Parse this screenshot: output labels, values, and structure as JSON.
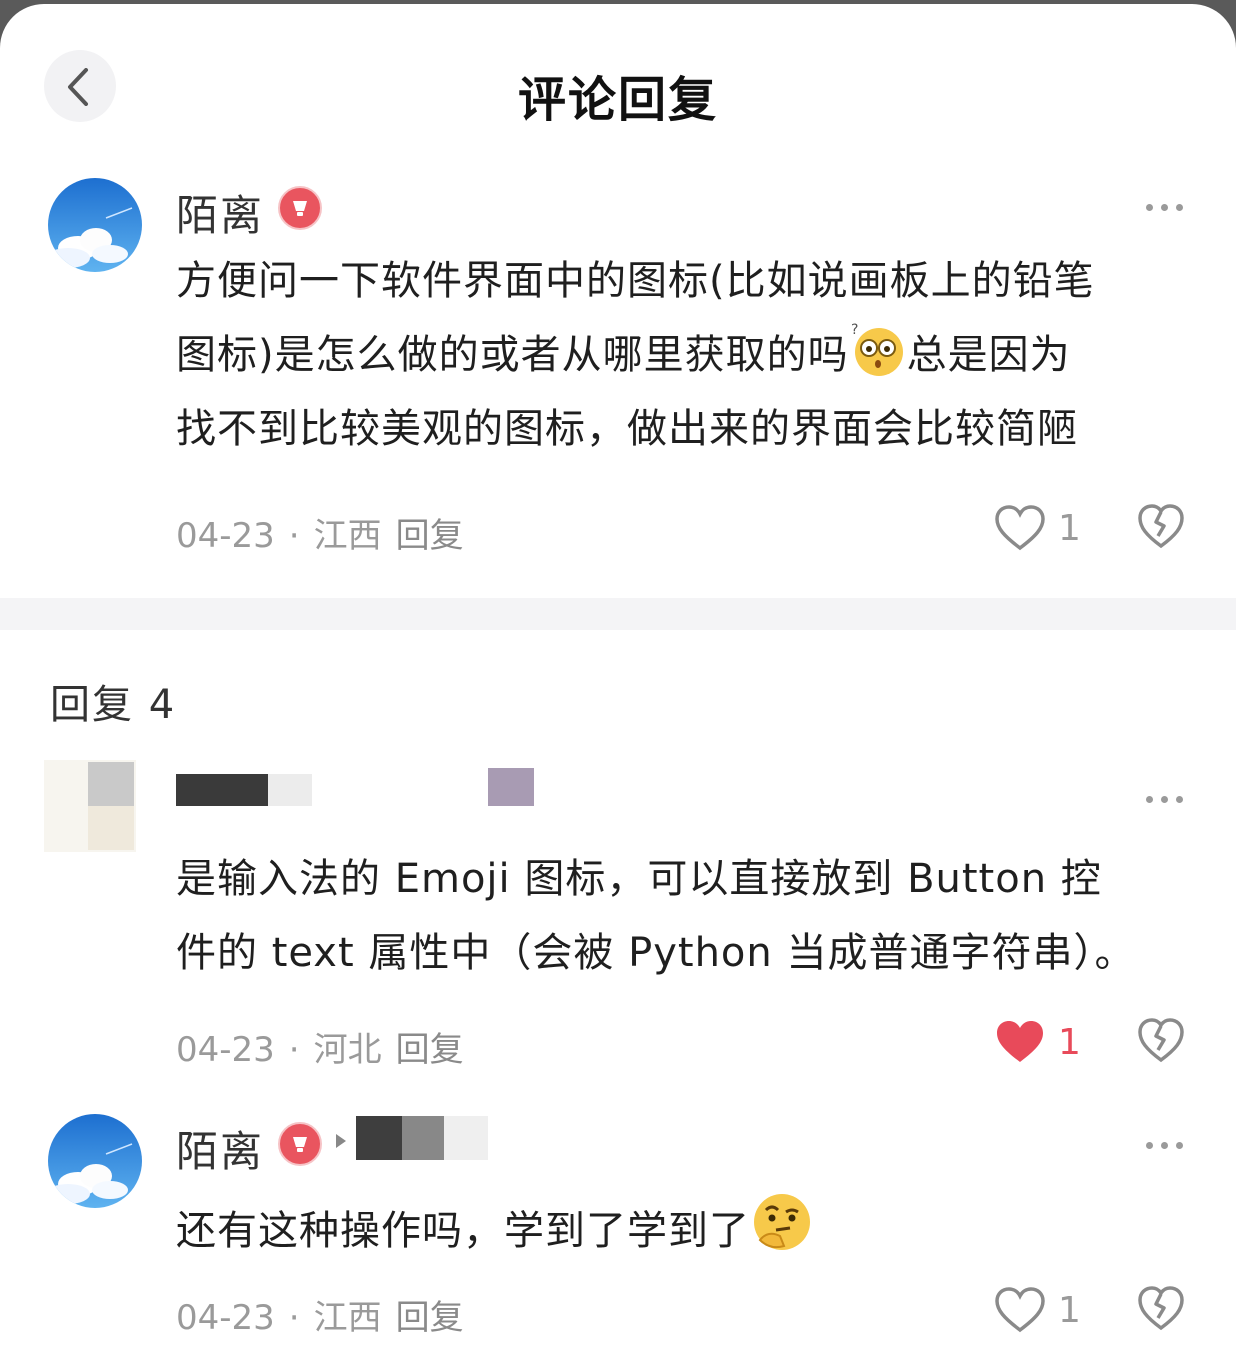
{
  "header": {
    "title": "评论回复"
  },
  "main_comment": {
    "username": "陌离",
    "lines": [
      "方便问一下软件界面中的图标(比如说画板上的铅笔",
      "图标)是怎么做的或者从哪里获取的吗",
      "总是因为",
      "找不到比较美观的图标，做出来的界面会比较简陋"
    ],
    "date": "04-23",
    "location": "江西",
    "reply_label": "回复",
    "likes": "1"
  },
  "replies_heading": "回复 4",
  "replies": [
    {
      "lines": [
        "是输入法的 Emoji 图标，可以直接放到 Button 控",
        "件的 text 属性中（会被 Python 当成普通字符串）。"
      ],
      "date": "04-23",
      "location": "河北",
      "reply_label": "回复",
      "likes": "1",
      "liked": true
    },
    {
      "username": "陌离",
      "text": "还有这种操作吗，学到了学到了",
      "date": "04-23",
      "location": "江西",
      "reply_label": "回复",
      "likes": "1",
      "liked": false
    }
  ],
  "colors": {
    "like_red": "#e84a5a",
    "badge_red": "#e9555f",
    "divider": "#f4f4f6"
  },
  "icons": {
    "back": "chevron-left-icon",
    "badge": "cup-badge-icon",
    "more": "more-dots-icon",
    "like": "heart-icon",
    "dislike": "broken-heart-icon",
    "emoji_1": "surprised-face-emoji",
    "emoji_2": "thinking-face-emoji"
  }
}
